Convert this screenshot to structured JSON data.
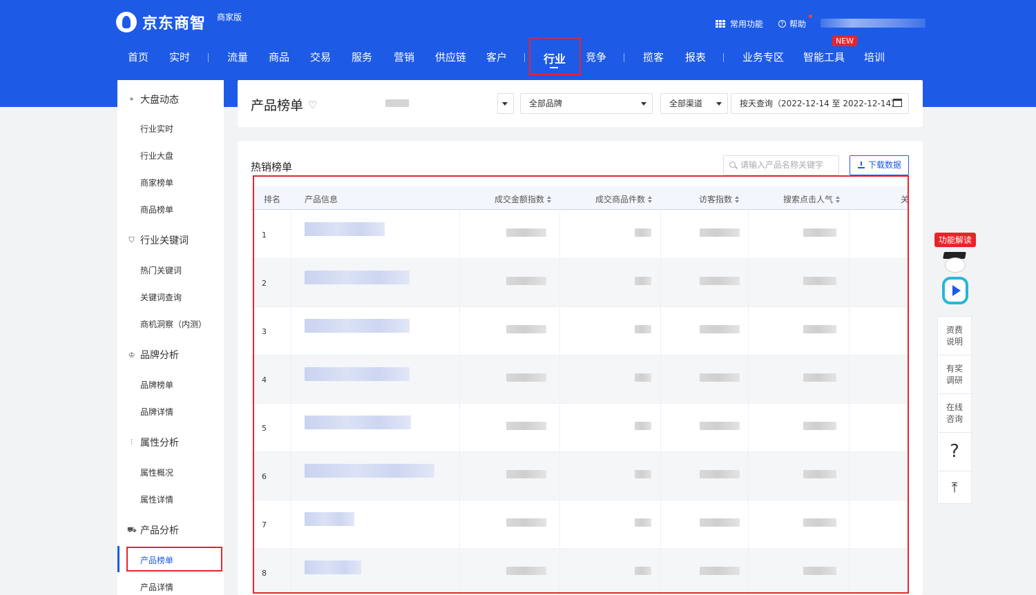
{
  "app": {
    "logo_text": "京东商智",
    "edition": "商家版",
    "common_functions": "常用功能",
    "help": "帮助",
    "new_badge": "NEW"
  },
  "nav": [
    "首页",
    "实时",
    "流量",
    "商品",
    "交易",
    "服务",
    "营销",
    "供应链",
    "客户",
    "行业",
    "竞争",
    "揽客",
    "报表",
    "业务专区",
    "智能工具",
    "培训"
  ],
  "nav_active": "行业",
  "sidebar": {
    "groups": [
      {
        "label": "大盘动态",
        "icon": "pulse-icon",
        "items": [
          "行业实时",
          "行业大盘",
          "商家榜单",
          "商品榜单"
        ]
      },
      {
        "label": "行业关键词",
        "icon": "shield-icon",
        "items": [
          "热门关键词",
          "关键词查询",
          "商机洞察（内测）"
        ]
      },
      {
        "label": "品牌分析",
        "icon": "crown-icon",
        "items": [
          "品牌榜单",
          "品牌详情"
        ]
      },
      {
        "label": "属性分析",
        "icon": "sliders-icon",
        "items": [
          "属性概况",
          "属性详情"
        ]
      },
      {
        "label": "产品分析",
        "icon": "cart-icon",
        "items": [
          "产品榜单",
          "产品详情"
        ]
      }
    ],
    "active_item": "产品榜单"
  },
  "filters": {
    "page_title": "产品榜单",
    "brand": "全部品牌",
    "channel": "全部渠道",
    "date": "按天查询（2022-12-14 至 2022-12-14）"
  },
  "panel": {
    "title": "热销榜单",
    "search_placeholder": "请输入产品名称关键字",
    "download": "下载数据"
  },
  "table": {
    "columns": [
      "排名",
      "产品信息",
      "成交金额指数",
      "成交商品件数",
      "访客指数",
      "搜索点击人气",
      "关"
    ],
    "ranks": [
      "1",
      "2",
      "3",
      "4",
      "5",
      "6",
      "7",
      "8"
    ]
  },
  "side_tools": {
    "feature_badge": "功能解读",
    "items": [
      "资费\n说明",
      "有奖\n调研",
      "在线\n咨询"
    ],
    "help_glyph": "?",
    "top_glyph": "⤒"
  },
  "colors": {
    "brand": "#1d5ae6",
    "highlight": "#e8242b"
  }
}
